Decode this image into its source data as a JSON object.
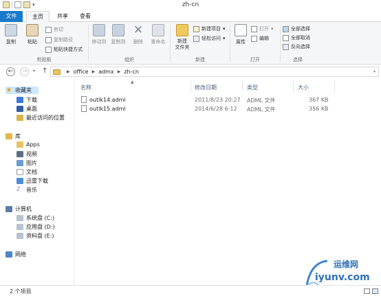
{
  "window": {
    "title": "zh-cn"
  },
  "tabs": {
    "file": "文件",
    "home": "主页",
    "share": "共享",
    "view": "查看"
  },
  "ribbon": {
    "clipboard": {
      "copy": "复制",
      "paste": "粘贴",
      "cut": "剪切",
      "copy_path": "复制路径",
      "paste_shortcut": "粘贴快捷方式",
      "label": "剪贴板"
    },
    "organize": {
      "move_to": "移动到",
      "copy_to": "复制到",
      "delete": "删除",
      "rename": "重命名",
      "label": "组织"
    },
    "new": {
      "new_folder": "新建\n文件夹",
      "new_item": "新建项目",
      "easy_access": "轻松访问",
      "label": "新建"
    },
    "open": {
      "properties": "属性",
      "open": "打开",
      "edit": "编辑",
      "label": "打开"
    },
    "select": {
      "select_all": "全部选择",
      "select_none": "全部取消",
      "invert": "反向选择",
      "label": "选择"
    }
  },
  "address": {
    "crumbs": [
      "office",
      "admx",
      "zh-cn"
    ]
  },
  "nav": {
    "favorites": "收藏夹",
    "fav_items": [
      "下载",
      "桌面",
      "最近访问的位置"
    ],
    "library": "库",
    "lib_items": [
      "Apps",
      "视频",
      "图片",
      "文档",
      "迅雷下载",
      "音乐"
    ],
    "computer": "计算机",
    "drives": [
      "系统盘 (C:)",
      "应用盘 (D:)",
      "资料盘 (E:)"
    ],
    "network": "网络"
  },
  "columns": {
    "name": "名称",
    "date": "修改日期",
    "type": "类型",
    "size": "大小"
  },
  "files": [
    {
      "name": "outlk14.adml",
      "date": "2011/8/23 20:27",
      "type": "ADML 文件",
      "size": "367 KB"
    },
    {
      "name": "outlk15.adml",
      "date": "2014/6/28 6:12",
      "type": "ADML 文件",
      "size": "356 KB"
    }
  ],
  "status": {
    "count": "2 个项目"
  },
  "watermark": {
    "cn": "运维网",
    "en": "iyunv.com"
  }
}
